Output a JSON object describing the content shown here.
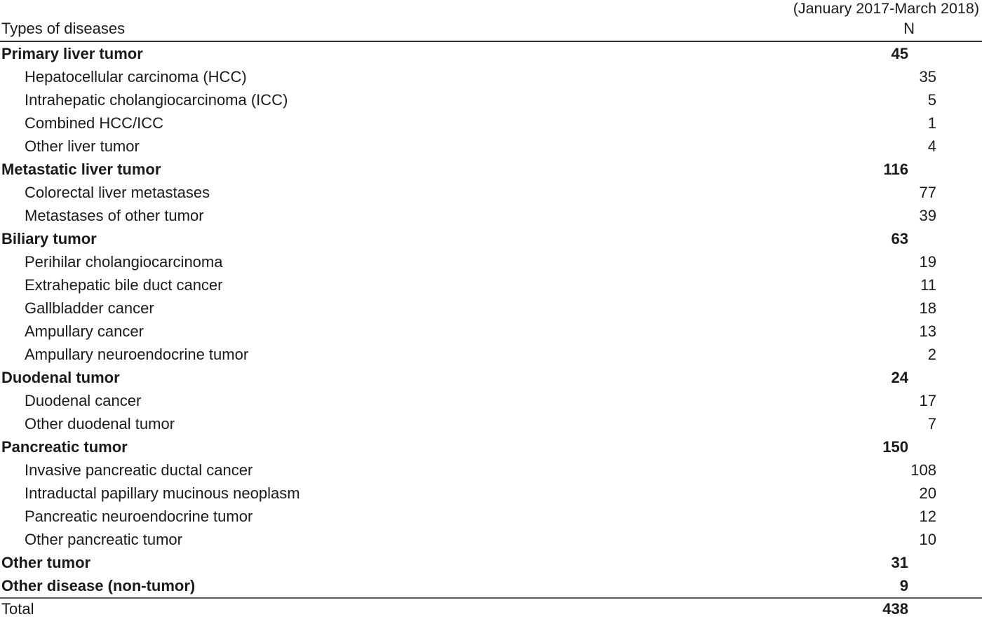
{
  "caption": "(January 2017-March 2018)",
  "header": {
    "label": "Types of diseases",
    "count": "N"
  },
  "rows": [
    {
      "type": "group",
      "label": "Primary liver tumor",
      "n": "45"
    },
    {
      "type": "item",
      "label": "Hepatocellular carcinoma (HCC)",
      "n": "35"
    },
    {
      "type": "item",
      "label": "Intrahepatic cholangiocarcinoma (ICC)",
      "n": "5"
    },
    {
      "type": "item",
      "label": "Combined HCC/ICC",
      "n": "1"
    },
    {
      "type": "item",
      "label": "Other liver tumor",
      "n": "4"
    },
    {
      "type": "group",
      "label": "Metastatic liver tumor",
      "n": "116"
    },
    {
      "type": "item",
      "label": "Colorectal liver metastases",
      "n": "77"
    },
    {
      "type": "item",
      "label": "Metastases of other tumor",
      "n": "39"
    },
    {
      "type": "group",
      "label": "Biliary tumor",
      "n": "63"
    },
    {
      "type": "item",
      "label": "Perihilar cholangiocarcinoma",
      "n": "19"
    },
    {
      "type": "item",
      "label": "Extrahepatic bile duct cancer",
      "n": "11"
    },
    {
      "type": "item",
      "label": "Gallbladder cancer",
      "n": "18"
    },
    {
      "type": "item",
      "label": "Ampullary cancer",
      "n": "13"
    },
    {
      "type": "item",
      "label": "Ampullary neuroendocrine tumor",
      "n": "2"
    },
    {
      "type": "group",
      "label": "Duodenal tumor",
      "n": "24"
    },
    {
      "type": "item",
      "label": "Duodenal cancer",
      "n": "17"
    },
    {
      "type": "item",
      "label": "Other duodenal tumor",
      "n": "7"
    },
    {
      "type": "group",
      "label": "Pancreatic tumor",
      "n": "150"
    },
    {
      "type": "item",
      "label": "Invasive pancreatic ductal cancer",
      "n": "108"
    },
    {
      "type": "item",
      "label": "Intraductal papillary mucinous neoplasm",
      "n": "20"
    },
    {
      "type": "item",
      "label": "Pancreatic neuroendocrine tumor",
      "n": "12"
    },
    {
      "type": "item",
      "label": "Other pancreatic tumor",
      "n": "10"
    },
    {
      "type": "group",
      "label": "Other tumor",
      "n": "31"
    },
    {
      "type": "group",
      "label": "Other disease (non-tumor)",
      "n": "9"
    }
  ],
  "total": {
    "label": "Total",
    "n": "438"
  },
  "colors": {
    "text": "#1a1a1a",
    "rule_header": "#2b2b2b",
    "rule_total": "#5a5a5a",
    "background": "#ffffff"
  }
}
